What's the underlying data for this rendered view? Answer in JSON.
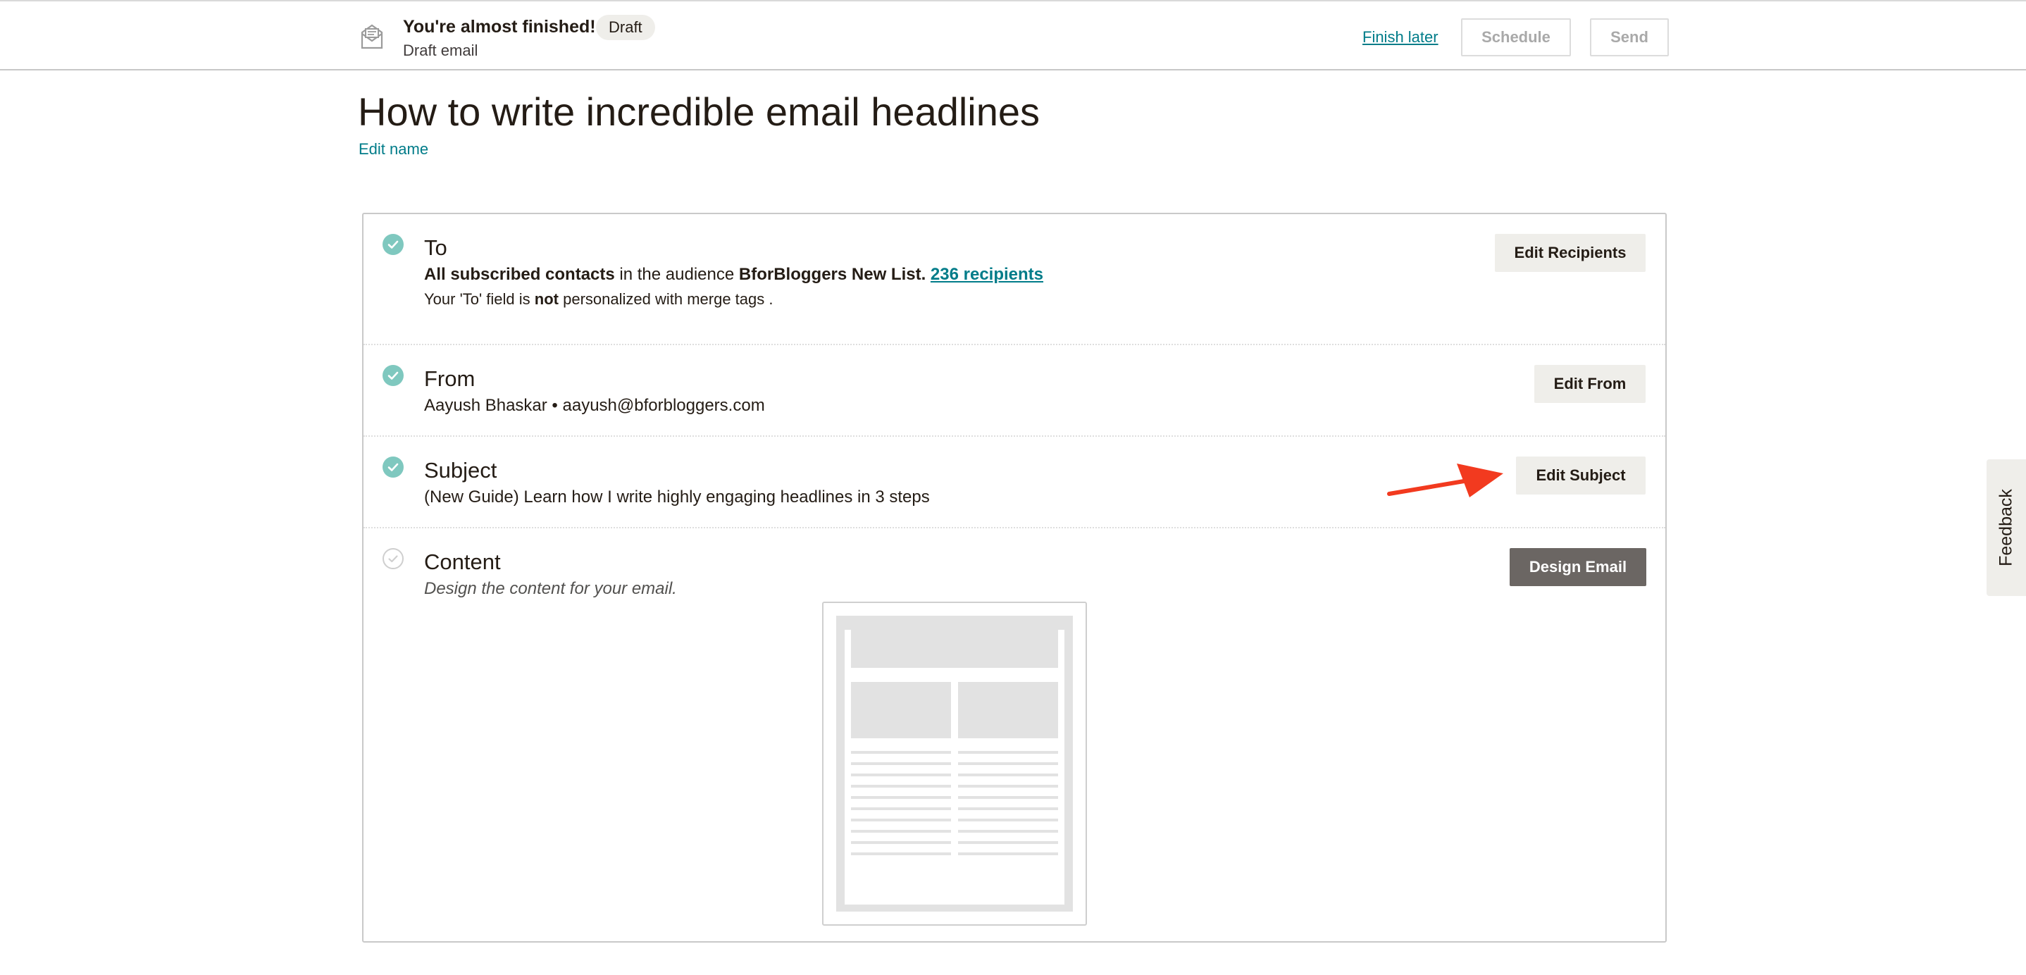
{
  "header": {
    "title": "You're almost finished!",
    "badge": "Draft",
    "subtitle": "Draft email",
    "finish_later": "Finish later",
    "schedule": "Schedule",
    "send": "Send"
  },
  "campaign": {
    "name": "How to write incredible email headlines",
    "edit_name": "Edit name"
  },
  "checklist": {
    "to": {
      "title": "To",
      "line_bold_1": "All subscribed contacts",
      "line_text_1": " in the audience ",
      "line_bold_2": "BforBloggers New List.",
      "recipients_link": "236 recipients",
      "note_prefix": "Your 'To' field is ",
      "note_bold": "not",
      "note_suffix": " personalized with merge tags .",
      "button": "Edit Recipients",
      "status": "complete"
    },
    "from": {
      "title": "From",
      "value": "Aayush Bhaskar • aayush@bforbloggers.com",
      "button": "Edit From",
      "status": "complete"
    },
    "subject": {
      "title": "Subject",
      "value": "(New Guide) Learn how I write highly engaging headlines in 3 steps",
      "button": "Edit Subject",
      "status": "complete"
    },
    "content": {
      "title": "Content",
      "value": "Design the content for your email.",
      "button": "Design Email",
      "status": "incomplete"
    }
  },
  "feedback": "Feedback",
  "colors": {
    "accent_link": "#007c89",
    "check_done": "#7fc8bf",
    "annotation_arrow": "#f23a1f",
    "dark_button": "#6b6663"
  }
}
